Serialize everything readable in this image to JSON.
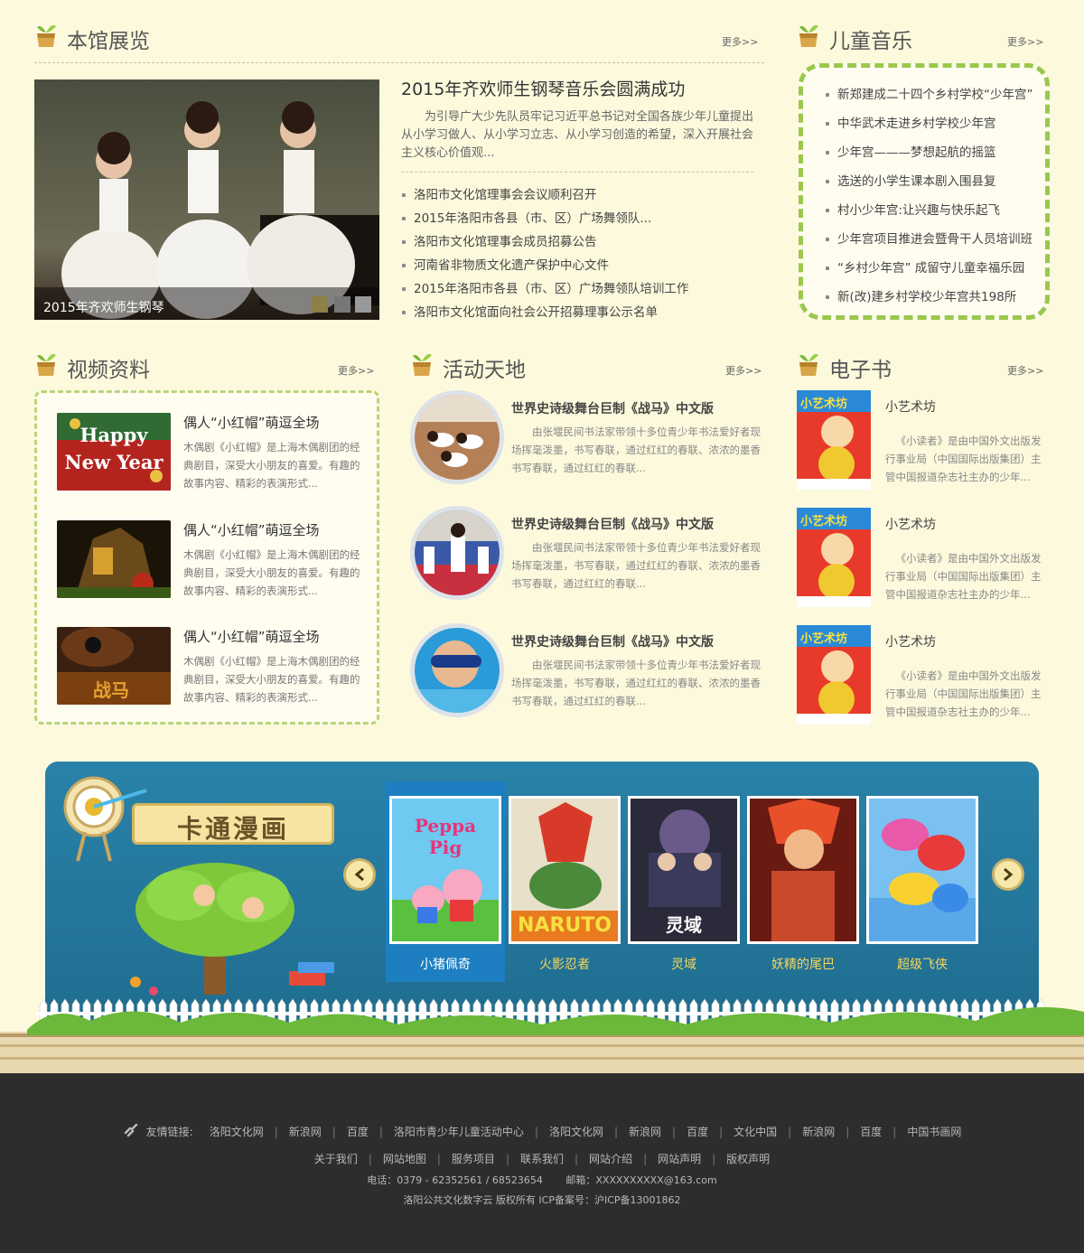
{
  "gallery": {
    "title": "本馆展览",
    "more": "更多>>",
    "caption": "2015年齐欢师生钢琴",
    "headline": "2015年齐欢师生钢琴音乐会圆满成功",
    "summary": "为引导广大少先队员牢记习近平总书记对全国各族少年儿童提出从小学习做人、从小学习立志、从小学习创造的希望，深入开展社会主义核心价值观...",
    "news": [
      "洛阳市文化馆理事会会议顺利召开",
      "2015年洛阳市各县（市、区）广场舞领队...",
      "洛阳市文化馆理事会成员招募公告",
      "河南省非物质文化遗产保护中心文件",
      "2015年洛阳市各县（市、区）广场舞领队培训工作",
      "洛阳市文化馆面向社会公开招募理事公示名单"
    ]
  },
  "music": {
    "title": "儿童音乐",
    "more": "更多>>",
    "items": [
      "新郑建成二十四个乡村学校“少年宫”",
      "中华武术走进乡村学校少年宫",
      "少年宫———梦想起航的摇篮",
      "选送的小学生课本剧入围县复",
      "村小少年宫:让兴趣与快乐起飞",
      "少年宫项目推进会暨骨干人员培训班",
      "“乡村少年宫” 成留守儿童幸福乐园",
      "新(改)建乡村学校少年宫共198所"
    ]
  },
  "video": {
    "title": "视频资料",
    "more": "更多>>",
    "items": [
      {
        "title": "偶人“小红帽”萌逗全场",
        "desc": "木偶剧《小红帽》是上海木偶剧团的经典剧目，深受大小朋友的喜爱。有趣的故事内容、精彩的表演形式...",
        "thumb_text": "Happy New Year"
      },
      {
        "title": "偶人“小红帽”萌逗全场",
        "desc": "木偶剧《小红帽》是上海木偶剧团的经典剧目，深受大小朋友的喜爱。有趣的故事内容、精彩的表演形式...",
        "thumb_text": ""
      },
      {
        "title": "偶人“小红帽”萌逗全场",
        "desc": "木偶剧《小红帽》是上海木偶剧团的经典剧目，深受大小朋友的喜爱。有趣的故事内容、精彩的表演形式...",
        "thumb_text": "战马"
      }
    ]
  },
  "activity": {
    "title": "活动天地",
    "more": "更多>>",
    "items": [
      {
        "title": "世界史诗级舞台巨制《战马》中文版",
        "desc": "由张堰民间书法家带领十多位青少年书法爱好者现场挥毫泼墨，书写春联，通过红红的春联、浓浓的墨香书写春联，通过红红的春联..."
      },
      {
        "title": "世界史诗级舞台巨制《战马》中文版",
        "desc": "由张堰民间书法家带领十多位青少年书法爱好者现场挥毫泼墨，书写春联，通过红红的春联、浓浓的墨香书写春联，通过红红的春联..."
      },
      {
        "title": "世界史诗级舞台巨制《战马》中文版",
        "desc": "由张堰民间书法家带领十多位青少年书法爱好者现场挥毫泼墨，书写春联，通过红红的春联、浓浓的墨香书写春联，通过红红的春联..."
      }
    ]
  },
  "ebook": {
    "title": "电子书",
    "more": "更多>>",
    "items": [
      {
        "title": "小艺术坊",
        "desc": "《小读者》是由中国外文出版发行事业局（中国国际出版集团）主管中国报道杂志社主办的少年...",
        "cover_text": "小艺术坊"
      },
      {
        "title": "小艺术坊",
        "desc": "《小读者》是由中国外文出版发行事业局（中国国际出版集团）主管中国报道杂志社主办的少年...",
        "cover_text": "小艺术坊"
      },
      {
        "title": "小艺术坊",
        "desc": "《小读者》是由中国外文出版发行事业局（中国国际出版集团）主管中国报道杂志社主办的少年...",
        "cover_text": "小艺术坊"
      }
    ]
  },
  "cartoon": {
    "title": "卡通漫画",
    "prev_icon": "chevron-left-icon",
    "next_icon": "chevron-right-icon",
    "items": [
      {
        "name": "小猪佩奇",
        "poster_text": "Peppa Pig",
        "active": true
      },
      {
        "name": "火影忍者",
        "poster_text": "NARUTO",
        "active": false
      },
      {
        "name": "灵域",
        "poster_text": "灵域",
        "active": false
      },
      {
        "name": "妖精的尾巴",
        "poster_text": "",
        "active": false
      },
      {
        "name": "超级飞侠",
        "poster_text": "",
        "active": false
      }
    ]
  },
  "footer": {
    "friend_label": "友情链接:",
    "friend_links": [
      "洛阳文化网",
      "新浪网",
      "百度",
      "洛阳市青少年儿童活动中心",
      "洛阳文化网",
      "新浪网",
      "百度",
      "文化中国",
      "新浪网",
      "百度",
      "中国书画网"
    ],
    "nav_links": [
      "关于我们",
      "网站地图",
      "服务项目",
      "联系我们",
      "网站介绍",
      "网站声明",
      "版权声明"
    ],
    "contact": "电话：0379 - 62352561 / 68523654　　 邮箱：XXXXXXXXXX@163.com",
    "copyright": "洛阳公共文化数字云 版权所有 ICP备案号：沪ICP备13001862"
  },
  "colors": {
    "page_bg": "#fdf9dd",
    "accent_green": "#9bc74d",
    "panel_blue": "#2a82a8",
    "active_card": "#1d7fc1",
    "footer_bg": "#2d2d2d"
  }
}
